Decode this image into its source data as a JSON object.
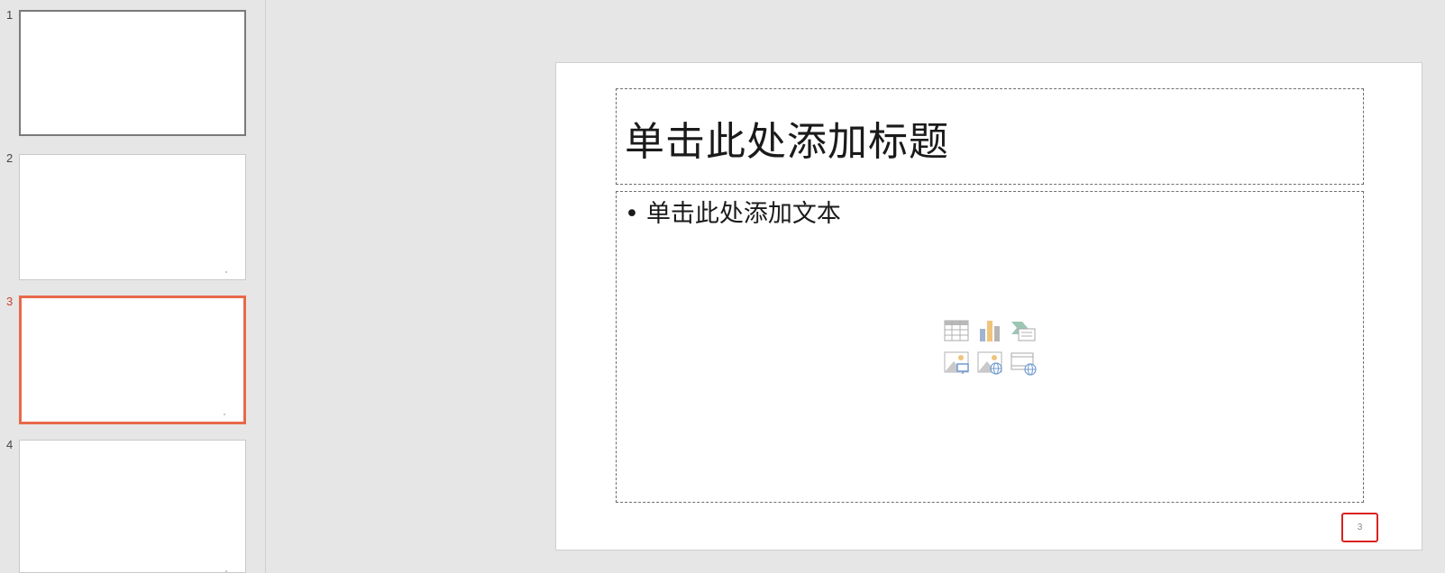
{
  "thumbnails": [
    {
      "number": "1"
    },
    {
      "number": "2"
    },
    {
      "number": "3"
    },
    {
      "number": "4"
    }
  ],
  "slide": {
    "title_placeholder": "单击此处添加标题",
    "body_placeholder": "单击此处添加文本",
    "bullet_glyph": "•",
    "page_number": "3",
    "insert_icons": [
      "table-icon",
      "chart-icon",
      "smartart-icon",
      "picture-icon",
      "online-picture-icon",
      "video-icon"
    ]
  },
  "colors": {
    "active_thumbnail": "#e8694a",
    "page_number_highlight": "#d8231f"
  }
}
